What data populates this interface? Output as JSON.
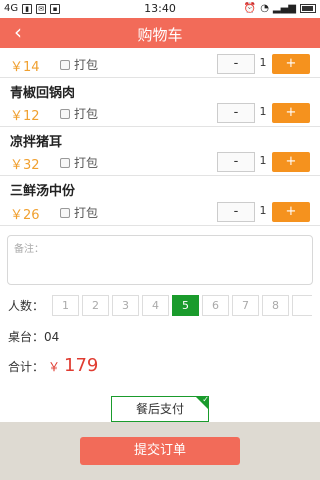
{
  "status_bar": {
    "network": "4G",
    "time": "13:40"
  },
  "header": {
    "back_icon": "chevron-left-icon",
    "title": "购物车"
  },
  "items": [
    {
      "name": "",
      "price": "￥14",
      "pack_label": "打包",
      "packed": false,
      "minus": "-",
      "quantity": "1",
      "plus": "+"
    },
    {
      "name": "青椒回锅肉",
      "price": "￥12",
      "pack_label": "打包",
      "packed": false,
      "minus": "-",
      "quantity": "1",
      "plus": "+"
    },
    {
      "name": "凉拌猪耳",
      "price": "￥32",
      "pack_label": "打包",
      "packed": false,
      "minus": "-",
      "quantity": "1",
      "plus": "+"
    },
    {
      "name": "三鲜汤中份",
      "price": "￥26",
      "pack_label": "打包",
      "packed": false,
      "minus": "-",
      "quantity": "1",
      "plus": "+"
    }
  ],
  "remark": {
    "placeholder": "备注："
  },
  "people": {
    "label": "人数：",
    "options": [
      "1",
      "2",
      "3",
      "4",
      "5",
      "6",
      "7",
      "8"
    ],
    "selected": "5"
  },
  "table": {
    "label": "桌台：",
    "value": "04"
  },
  "total": {
    "label": "合计：",
    "currency": "￥",
    "value": "179"
  },
  "payment": {
    "label": "餐后支付",
    "selected": true
  },
  "submit": {
    "label": "提交订单"
  },
  "colors": {
    "header": "#f26b59",
    "plus_button": "#f5921e",
    "price": "#f0a030",
    "selected_green": "#1a9b2c",
    "total_red": "#e03c31"
  }
}
